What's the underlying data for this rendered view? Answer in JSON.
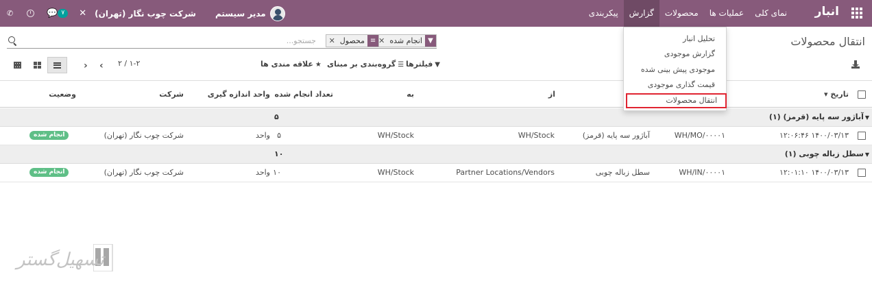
{
  "navbar": {
    "brand": "انبار",
    "menu": [
      "نمای کلی",
      "عملیات ها",
      "محصولات",
      "گزارش",
      "پیکربندی"
    ],
    "active_menu": "گزارش",
    "user": "مدیر سیستم",
    "company": "شرکت چوب نگار (تهران)",
    "chat_count": "۷",
    "brand_color": "#875a7b"
  },
  "dropdown": {
    "items": [
      "تحلیل انبار",
      "گزارش موجودی",
      "موجودی پیش بینی شده",
      "قیمت گذاری موجودی",
      "انتقال محصولات"
    ],
    "highlighted": "انتقال محصولات"
  },
  "control_panel": {
    "title": "انتقال محصولات",
    "facets": [
      {
        "label": "انجام شده",
        "icon": "filter-icon"
      },
      {
        "label": "محصول",
        "icon": "group-by-icon"
      }
    ],
    "search_placeholder": "جستجو...",
    "filters_label": "فیلترها",
    "groupby_label": "گروه‌بندی بر مبنای",
    "favorites_label": "علاقه مندی ها",
    "pager": "۱-۲ / ۲"
  },
  "table": {
    "headers": {
      "date": "تاریخ",
      "reference": "",
      "product": "",
      "from": "از",
      "to": "به",
      "qty_done": "تعداد انجام شده",
      "uom": "واحد اندازه گیری",
      "company": "شرکت",
      "status": "وضعیت"
    },
    "groups": [
      {
        "name": "آباژور سه پایه (قرمز) (۱)",
        "sum": "۵",
        "rows": [
          {
            "date": "۱۴۰۰/۰۳/۱۳ ۱۲:۰۶:۴۶",
            "reference": "WH/MO/۰۰۰۰۱",
            "product": "آباژور سه پایه (قرمز)",
            "from": "WH/Stock",
            "to": "WH/Stock",
            "qty_done": "۵",
            "uom": "واحد",
            "company": "شرکت چوب نگار (تهران)",
            "status": "انجام شده"
          }
        ]
      },
      {
        "name": "سطل زباله چوبی (۱)",
        "sum": "۱۰",
        "rows": [
          {
            "date": "۱۴۰۰/۰۳/۱۳ ۱۲:۰۱:۱۰",
            "reference": "WH/IN/۰۰۰۰۱",
            "product": "سطل زباله چوبی",
            "from": "Partner Locations/Vendors",
            "to": "WH/Stock",
            "qty_done": "۱۰",
            "uom": "واحد",
            "company": "شرکت چوب نگار (تهران)",
            "status": "انجام شده"
          }
        ]
      }
    ]
  },
  "watermark": {
    "text": "تسهیل‌گستر"
  }
}
